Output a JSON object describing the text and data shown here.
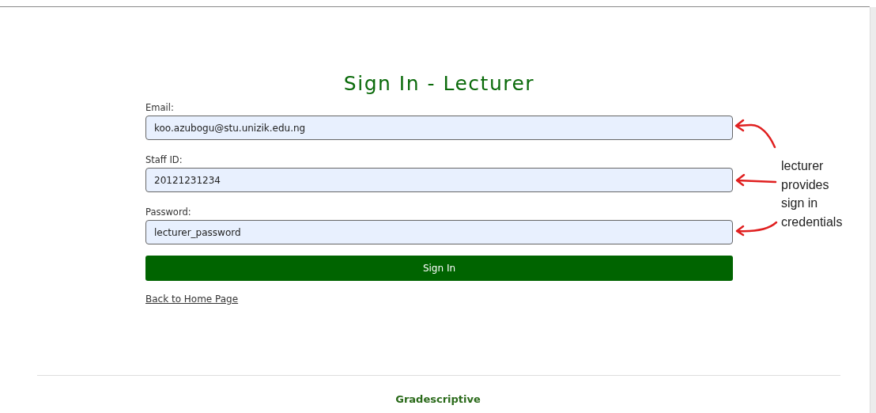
{
  "title": "Sign In - Lecturer",
  "fields": [
    {
      "label": "Email:",
      "value": "koo.azubogu@stu.unizik.edu.ng"
    },
    {
      "label": "Staff ID:",
      "value": "20121231234"
    },
    {
      "label": "Password:",
      "value": "lecturer_password"
    }
  ],
  "button": "Sign In",
  "link": "Back to Home Page",
  "footer": "Gradescriptive",
  "annotation": {
    "note": "lecturer provides sign in credentials"
  }
}
